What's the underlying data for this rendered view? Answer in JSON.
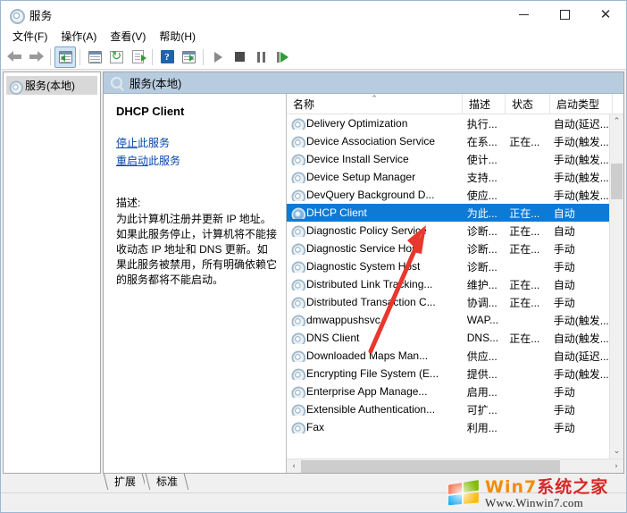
{
  "window": {
    "title": "服务",
    "icon": "services-gear-icon",
    "controls": {
      "minimize": "—",
      "maximize": "□",
      "close": "✕"
    }
  },
  "menu": {
    "items": [
      {
        "label": "文件(F)",
        "name": "menu-file"
      },
      {
        "label": "操作(A)",
        "name": "menu-action"
      },
      {
        "label": "查看(V)",
        "name": "menu-view"
      },
      {
        "label": "帮助(H)",
        "name": "menu-help"
      }
    ]
  },
  "toolbar": {
    "items": [
      {
        "name": "back-button",
        "icon": "arrow-left-icon"
      },
      {
        "name": "forward-button",
        "icon": "arrow-right-icon"
      },
      {
        "name": "show-hide-tree-button",
        "icon": "console-tree-icon"
      },
      {
        "name": "properties-button",
        "icon": "properties-icon"
      },
      {
        "name": "refresh-button",
        "icon": "refresh-icon"
      },
      {
        "name": "export-list-button",
        "icon": "export-icon"
      },
      {
        "name": "help-button",
        "icon": "help-question-icon"
      },
      {
        "name": "show-action-pane-button",
        "icon": "action-pane-icon"
      },
      {
        "name": "start-service-button",
        "icon": "play-icon"
      },
      {
        "name": "stop-service-button",
        "icon": "stop-icon"
      },
      {
        "name": "pause-service-button",
        "icon": "pause-icon"
      },
      {
        "name": "restart-service-button",
        "icon": "restart-icon"
      }
    ]
  },
  "tree": {
    "nodes": [
      {
        "label": "服务(本地)",
        "name": "tree-node-services-local",
        "icon": "services-gear-icon"
      }
    ]
  },
  "pane": {
    "header": "服务(本地)",
    "header_icon": "magnifier-icon"
  },
  "detail": {
    "service_name": "DHCP Client",
    "links": [
      {
        "verb": "停止",
        "rest": "此服务",
        "name": "stop-service-link"
      },
      {
        "verb": "重启动",
        "rest": "此服务",
        "name": "restart-service-link"
      }
    ],
    "description_label": "描述:",
    "description": "为此计算机注册并更新 IP 地址。如果此服务停止，计算机将不能接收动态 IP 地址和 DNS 更新。如果此服务被禁用，所有明确依赖它的服务都将不能启动。"
  },
  "list": {
    "columns": [
      {
        "label": "名称",
        "name": "column-name",
        "width": 197,
        "sorted": true,
        "sort_caret": "⌃"
      },
      {
        "label": "描述",
        "name": "column-description",
        "width": 48
      },
      {
        "label": "状态",
        "name": "column-status",
        "width": 50
      },
      {
        "label": "启动类型",
        "name": "column-startup-type",
        "width": 70
      }
    ],
    "rows": [
      {
        "name": "Delivery Optimization",
        "description": "执行...",
        "status": "",
        "startup": "自动(延迟..."
      },
      {
        "name": "Device Association Service",
        "description": "在系...",
        "status": "正在...",
        "startup": "手动(触发..."
      },
      {
        "name": "Device Install Service",
        "description": "使计...",
        "status": "",
        "startup": "手动(触发..."
      },
      {
        "name": "Device Setup Manager",
        "description": "支持...",
        "status": "",
        "startup": "手动(触发..."
      },
      {
        "name": "DevQuery Background D...",
        "description": "使应...",
        "status": "",
        "startup": "手动(触发..."
      },
      {
        "name": "DHCP Client",
        "description": "为此...",
        "status": "正在...",
        "startup": "自动",
        "selected": true
      },
      {
        "name": "Diagnostic Policy Service",
        "description": "诊断...",
        "status": "正在...",
        "startup": "自动"
      },
      {
        "name": "Diagnostic Service Host",
        "description": "诊断...",
        "status": "正在...",
        "startup": "手动"
      },
      {
        "name": "Diagnostic System Host",
        "description": "诊断...",
        "status": "",
        "startup": "手动"
      },
      {
        "name": "Distributed Link Tracking...",
        "description": "维护...",
        "status": "正在...",
        "startup": "自动"
      },
      {
        "name": "Distributed Transaction C...",
        "description": "协调...",
        "status": "正在...",
        "startup": "手动"
      },
      {
        "name": "dmwappushsvc",
        "description": "WAP...",
        "status": "",
        "startup": "手动(触发..."
      },
      {
        "name": "DNS Client",
        "description": "DNS...",
        "status": "正在...",
        "startup": "自动(触发..."
      },
      {
        "name": "Downloaded Maps Man...",
        "description": "供应...",
        "status": "",
        "startup": "自动(延迟..."
      },
      {
        "name": "Encrypting File System (E...",
        "description": "提供...",
        "status": "",
        "startup": "手动(触发..."
      },
      {
        "name": "Enterprise App Manage...",
        "description": "启用...",
        "status": "",
        "startup": "手动"
      },
      {
        "name": "Extensible Authentication...",
        "description": "可扩...",
        "status": "",
        "startup": "手动"
      },
      {
        "name": "Fax",
        "description": "利用...",
        "status": "",
        "startup": "手动"
      }
    ],
    "scroll": {
      "up_arrow": "⌃",
      "down_arrow": "⌄",
      "left_arrow": "‹",
      "right_arrow": "›"
    }
  },
  "tabs": [
    {
      "label": "扩展",
      "name": "tab-extended"
    },
    {
      "label": "标准",
      "name": "tab-standard"
    }
  ],
  "annotation": {
    "type": "red-arrow",
    "color": "#e8372c",
    "points_to": "DHCP Client"
  },
  "watermark": {
    "title_w7": "Win7",
    "title_cn": "系统之家",
    "url": "Www.Winwin7.com",
    "flag_colors": [
      "#f25022",
      "#7fba00",
      "#00a4ef",
      "#ffb900"
    ]
  },
  "colors": {
    "selection": "#0d7ad6",
    "pane_header": "#b8cce0",
    "link": "#0645ad",
    "annotation": "#e8372c"
  }
}
